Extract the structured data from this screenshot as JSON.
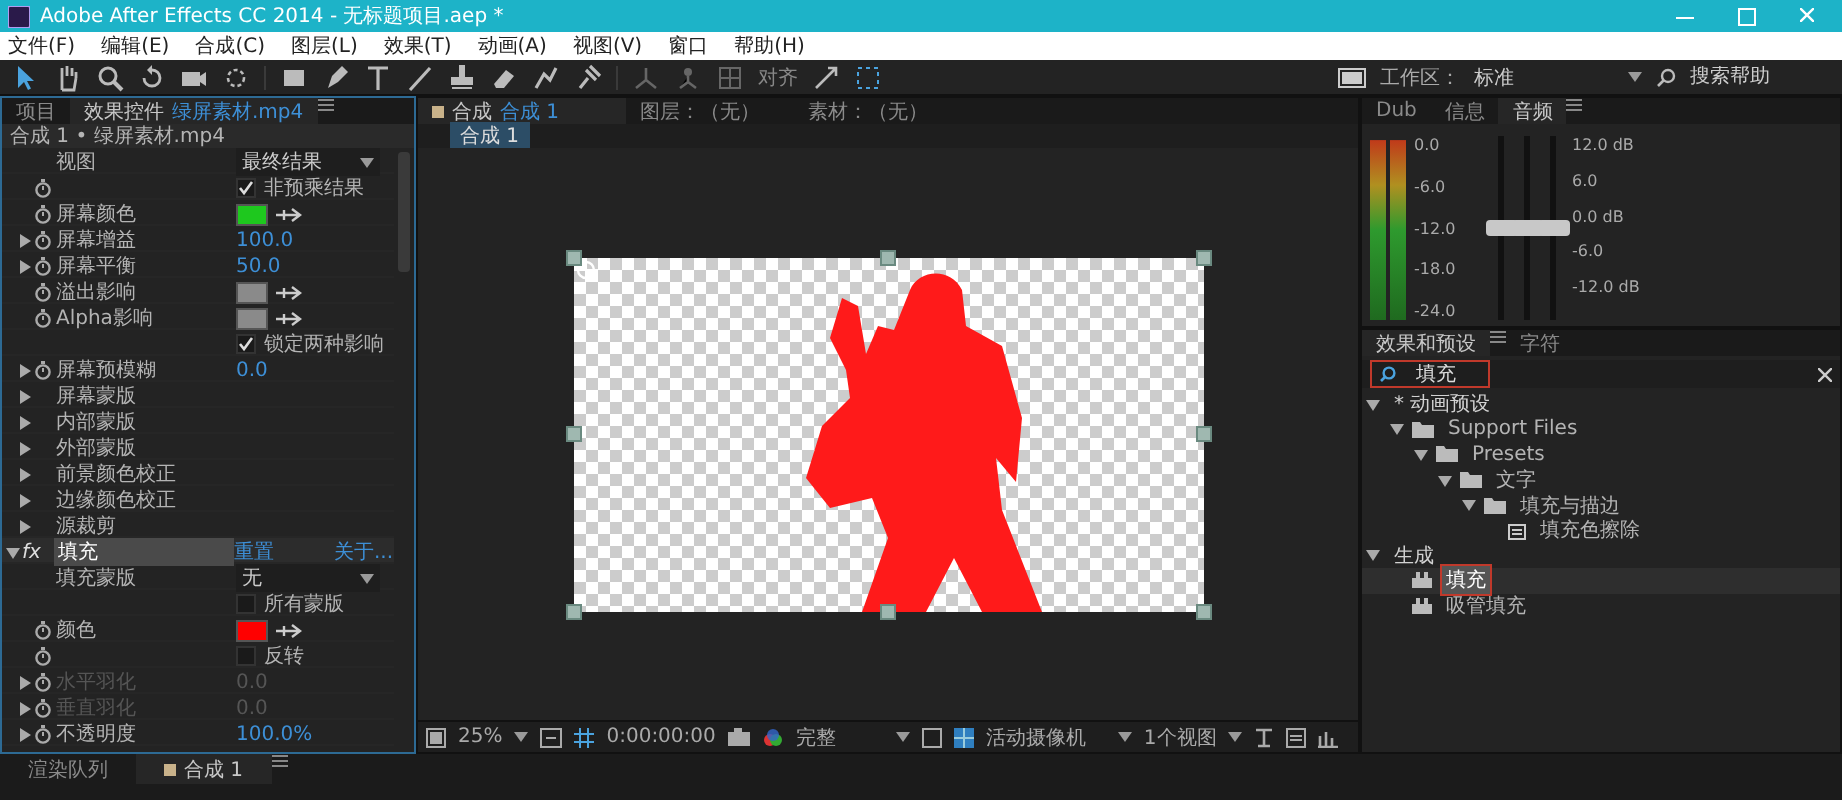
{
  "window": {
    "title": "Adobe After Effects CC 2014 - 无标题项目.aep *"
  },
  "menu": [
    "文件(F)",
    "编辑(E)",
    "合成(C)",
    "图层(L)",
    "效果(T)",
    "动画(A)",
    "视图(V)",
    "窗口",
    "帮助(H)"
  ],
  "toolbar": {
    "align_label": "对齐",
    "workspace_label": "工作区：",
    "workspace": "标准",
    "search_placeholder": "搜索帮助"
  },
  "left_panel": {
    "tabs": [
      {
        "label": "项目",
        "selected": false
      },
      {
        "label": "效果控件",
        "doc": "绿屏素材.mp4",
        "selected": true
      }
    ],
    "header": "合成 1 • 绿屏素材.mp4",
    "rows": [
      {
        "kind": "dropdown",
        "label": "视图",
        "value": "最终结果",
        "stopwatch": false,
        "disabled": false
      },
      {
        "kind": "checkbox",
        "text": "非预乘结果",
        "checked": true,
        "stopwatch": true,
        "disabled": false
      },
      {
        "kind": "color",
        "label": "屏幕颜色",
        "color": "#1ec81e",
        "stopwatch": true,
        "disabled": false
      },
      {
        "kind": "number",
        "label": "屏幕增益",
        "value": "100.0",
        "expanded": false,
        "stopwatch": true,
        "disabled": false
      },
      {
        "kind": "number",
        "label": "屏幕平衡",
        "value": "50.0",
        "expanded": false,
        "stopwatch": true,
        "disabled": false
      },
      {
        "kind": "color",
        "label": "溢出影响",
        "color": "#8a8a8a",
        "stopwatch": true,
        "disabled": false
      },
      {
        "kind": "color",
        "label": "Alpha影响",
        "color": "#8a8a8a",
        "stopwatch": true,
        "disabled": false
      },
      {
        "kind": "checkbox",
        "text": "锁定两种影响",
        "checked": true,
        "stopwatch": false,
        "disabled": false
      },
      {
        "kind": "number",
        "label": "屏幕预模糊",
        "value": "0.0",
        "expanded": false,
        "stopwatch": true,
        "disabled": false
      },
      {
        "kind": "group",
        "label": "屏幕蒙版",
        "expanded": false,
        "stopwatch": false,
        "disabled": false
      },
      {
        "kind": "group",
        "label": "内部蒙版",
        "expanded": false,
        "stopwatch": false,
        "disabled": false
      },
      {
        "kind": "group",
        "label": "外部蒙版",
        "expanded": false,
        "stopwatch": false,
        "disabled": false
      },
      {
        "kind": "group",
        "label": "前景颜色校正",
        "expanded": false,
        "stopwatch": false,
        "disabled": false
      },
      {
        "kind": "group",
        "label": "边缘颜色校正",
        "expanded": false,
        "stopwatch": false,
        "disabled": false
      },
      {
        "kind": "group",
        "label": "源裁剪",
        "expanded": false,
        "stopwatch": false,
        "disabled": false
      },
      {
        "kind": "effect",
        "badge": "fx",
        "label": "填充",
        "reset": "重置",
        "about": "关于...",
        "expanded": true,
        "selected": true,
        "stopwatch": false,
        "disabled": false
      },
      {
        "kind": "dropdown",
        "label": "填充蒙版",
        "value": "无",
        "stopwatch": false,
        "disabled": false
      },
      {
        "kind": "checkbox",
        "text": "所有蒙版",
        "checked": false,
        "stopwatch": false,
        "disabled": false
      },
      {
        "kind": "color",
        "label": "颜色",
        "color": "#ff0000",
        "stopwatch": true,
        "disabled": false
      },
      {
        "kind": "checkbox",
        "text": "反转",
        "checked": false,
        "stopwatch": true,
        "disabled": false
      },
      {
        "kind": "number",
        "label": "水平羽化",
        "value": "0.0",
        "expanded": false,
        "stopwatch": true,
        "disabled": true
      },
      {
        "kind": "number",
        "label": "垂直羽化",
        "value": "0.0",
        "expanded": false,
        "stopwatch": true,
        "disabled": true
      },
      {
        "kind": "number",
        "label": "不透明度",
        "value": "100.0%",
        "expanded": false,
        "stopwatch": true,
        "disabled": false
      }
    ]
  },
  "center_panel": {
    "tabs": [
      {
        "label": "合成",
        "doc": "合成 1",
        "selected": true
      },
      {
        "label": "图层：（无）",
        "selected": false
      },
      {
        "label": "素材：（无）",
        "selected": false
      }
    ],
    "viewer_tab": "合成 1",
    "viewer_bar": {
      "zoom": "25%",
      "timecode": "0:00:00:00",
      "resolution": "完整",
      "camera": "活动摄像机",
      "views": "1个视图"
    }
  },
  "audio_panel": {
    "tabs": [
      {
        "label": "Dub",
        "selected": false
      },
      {
        "label": "信息",
        "selected": false
      },
      {
        "label": "音频",
        "selected": true
      }
    ],
    "meter_scale": [
      "0.0",
      "-6.0",
      "-12.0",
      "-18.0",
      "-24.0"
    ],
    "sliders": [
      {
        "level": 0.5
      },
      {
        "level": 0.5
      },
      {
        "level": 0.5
      }
    ],
    "slider_scale": [
      "12.0 dB",
      "6.0",
      "0.0 dB",
      "-6.0",
      "-12.0 dB"
    ]
  },
  "effects_panel": {
    "tabs": [
      {
        "label": "效果和预设",
        "selected": true
      },
      {
        "label": "字符",
        "selected": false
      }
    ],
    "search": {
      "value": "填充",
      "highlighted": true
    },
    "tree": [
      {
        "label": "* 动画预设",
        "kind": "category",
        "expanded": true,
        "children": [
          {
            "label": "Support Files",
            "kind": "folder",
            "expanded": true,
            "children": [
              {
                "label": "Presets",
                "kind": "folder",
                "expanded": true,
                "children": [
                  {
                    "label": "文字",
                    "kind": "folder",
                    "expanded": true,
                    "children": [
                      {
                        "label": "填充与描边",
                        "kind": "folder",
                        "expanded": true,
                        "children": [
                          {
                            "label": "填充色擦除",
                            "kind": "preset",
                            "selected": false,
                            "highlighted": false
                          }
                        ]
                      }
                    ]
                  }
                ]
              }
            ]
          }
        ]
      },
      {
        "label": "生成",
        "kind": "category",
        "expanded": true,
        "children": [
          {
            "label": "填充",
            "kind": "effect",
            "selected": true,
            "highlighted": true
          },
          {
            "label": "吸管填充",
            "kind": "effect",
            "selected": false,
            "highlighted": false
          }
        ]
      }
    ]
  },
  "bottom_panel": {
    "tabs": [
      {
        "label": "渲染队列",
        "selected": false
      },
      {
        "label": "合成 1",
        "selected": true
      }
    ]
  }
}
